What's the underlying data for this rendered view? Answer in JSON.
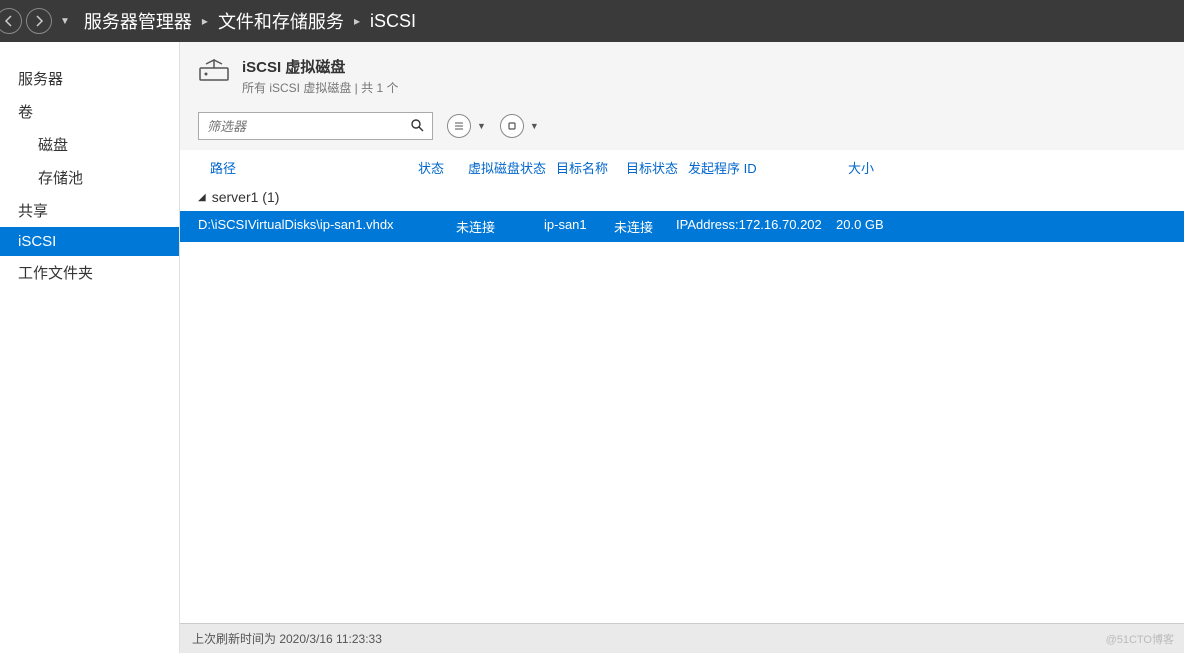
{
  "breadcrumb": {
    "a": "服务器管理器",
    "b": "文件和存储服务",
    "c": "iSCSI"
  },
  "sidebar": {
    "items": [
      {
        "label": "服务器"
      },
      {
        "label": "卷"
      },
      {
        "label": "磁盘"
      },
      {
        "label": "存储池"
      },
      {
        "label": "共享"
      },
      {
        "label": "iSCSI"
      },
      {
        "label": "工作文件夹"
      }
    ]
  },
  "section": {
    "title": "iSCSI 虚拟磁盘",
    "subtitle": "所有 iSCSI 虚拟磁盘 | 共 1 个"
  },
  "filter": {
    "placeholder": "筛选器"
  },
  "columns": {
    "path": "路径",
    "status": "状态",
    "vstatus": "虚拟磁盘状态",
    "target": "目标名称",
    "tstatus": "目标状态",
    "initiator": "发起程序 ID",
    "size": "大小"
  },
  "group": {
    "name": "server1 (1)"
  },
  "row": {
    "path": "D:\\iSCSIVirtualDisks\\ip-san1.vhdx",
    "status": "",
    "vstatus": "未连接",
    "target": "ip-san1",
    "tstatus": "未连接",
    "initiator": "IPAddress:172.16.70.202",
    "size": "20.0 GB"
  },
  "statusbar": {
    "text": "上次刷新时间为 2020/3/16 11:23:33"
  },
  "watermark": "@51CTO博客"
}
